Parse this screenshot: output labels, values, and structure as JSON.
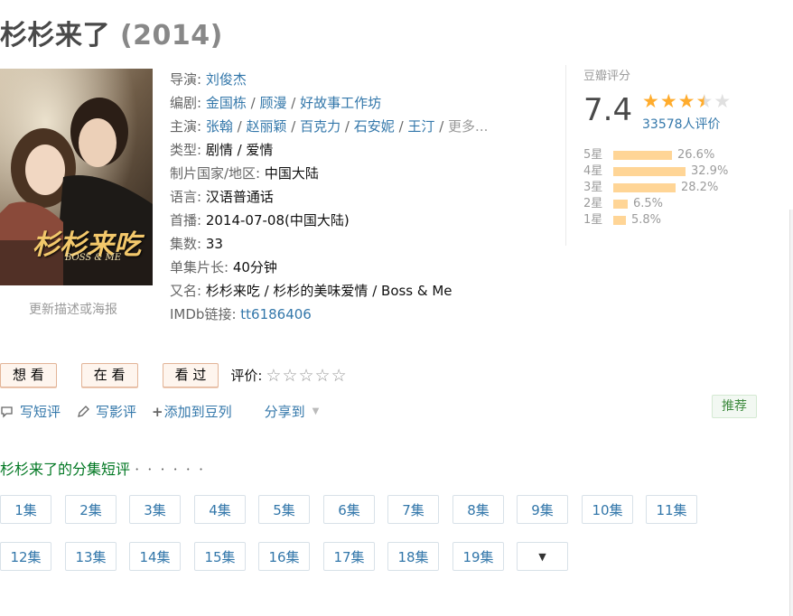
{
  "title": {
    "name": "杉杉来了",
    "year": "(2014)"
  },
  "poster": {
    "update_link": "更新描述或海报",
    "title_art": "杉杉来吃",
    "subtitle_art": "BOSS & ME"
  },
  "info": {
    "director": {
      "label": "导演:",
      "names": [
        "刘俊杰"
      ]
    },
    "writer": {
      "label": "编剧:",
      "names": [
        "金国栋",
        "顾漫",
        "好故事工作坊"
      ]
    },
    "cast": {
      "label": "主演:",
      "names": [
        "张翰",
        "赵丽颖",
        "百克力",
        "石安妮",
        "王汀"
      ],
      "more": "更多..."
    },
    "genre": {
      "label": "类型:",
      "value": "剧情 / 爱情"
    },
    "region": {
      "label": "制片国家/地区:",
      "value": "中国大陆"
    },
    "language": {
      "label": "语言:",
      "value": "汉语普通话"
    },
    "premiere": {
      "label": "首播:",
      "value": "2014-07-08(中国大陆)"
    },
    "episodes": {
      "label": "集数:",
      "value": "33"
    },
    "runtime": {
      "label": "单集片长:",
      "value": "40分钟"
    },
    "aka": {
      "label": "又名:",
      "value": "杉杉来吃 / 杉杉的美味爱情 / Boss & Me"
    },
    "imdb": {
      "label": "IMDb链接:",
      "value": "tt6186406"
    }
  },
  "rating": {
    "label": "豆瓣评分",
    "score": "7.4",
    "stars": 3.5,
    "count": "33578人评价",
    "distribution": [
      {
        "label": "5星",
        "pct": "26.6%",
        "value": 26.6
      },
      {
        "label": "4星",
        "pct": "32.9%",
        "value": 32.9
      },
      {
        "label": "3星",
        "pct": "28.2%",
        "value": 28.2
      },
      {
        "label": "2星",
        "pct": "6.5%",
        "value": 6.5
      },
      {
        "label": "1星",
        "pct": "5.8%",
        "value": 5.8
      }
    ]
  },
  "actions": {
    "want": "想 看",
    "doing": "在 看",
    "done": "看 过",
    "rate_label": "评价:"
  },
  "links": {
    "short_review": "写短评",
    "review": "写影评",
    "add_list": "添加到豆列",
    "share": "分享到"
  },
  "recommend": "推荐",
  "episodes_section": {
    "title": "杉杉来了的分集短评",
    "dots": "· · · · · ·",
    "episodes": [
      "1集",
      "2集",
      "3集",
      "4集",
      "5集",
      "6集",
      "7集",
      "8集",
      "9集",
      "10集",
      "11集",
      "12集",
      "13集",
      "14集",
      "15集",
      "16集",
      "17集",
      "18集",
      "19集"
    ]
  },
  "colors": {
    "link": "#3377aa",
    "star": "#ffac2d",
    "bar": "#ffd596",
    "section_title": "#007722"
  }
}
